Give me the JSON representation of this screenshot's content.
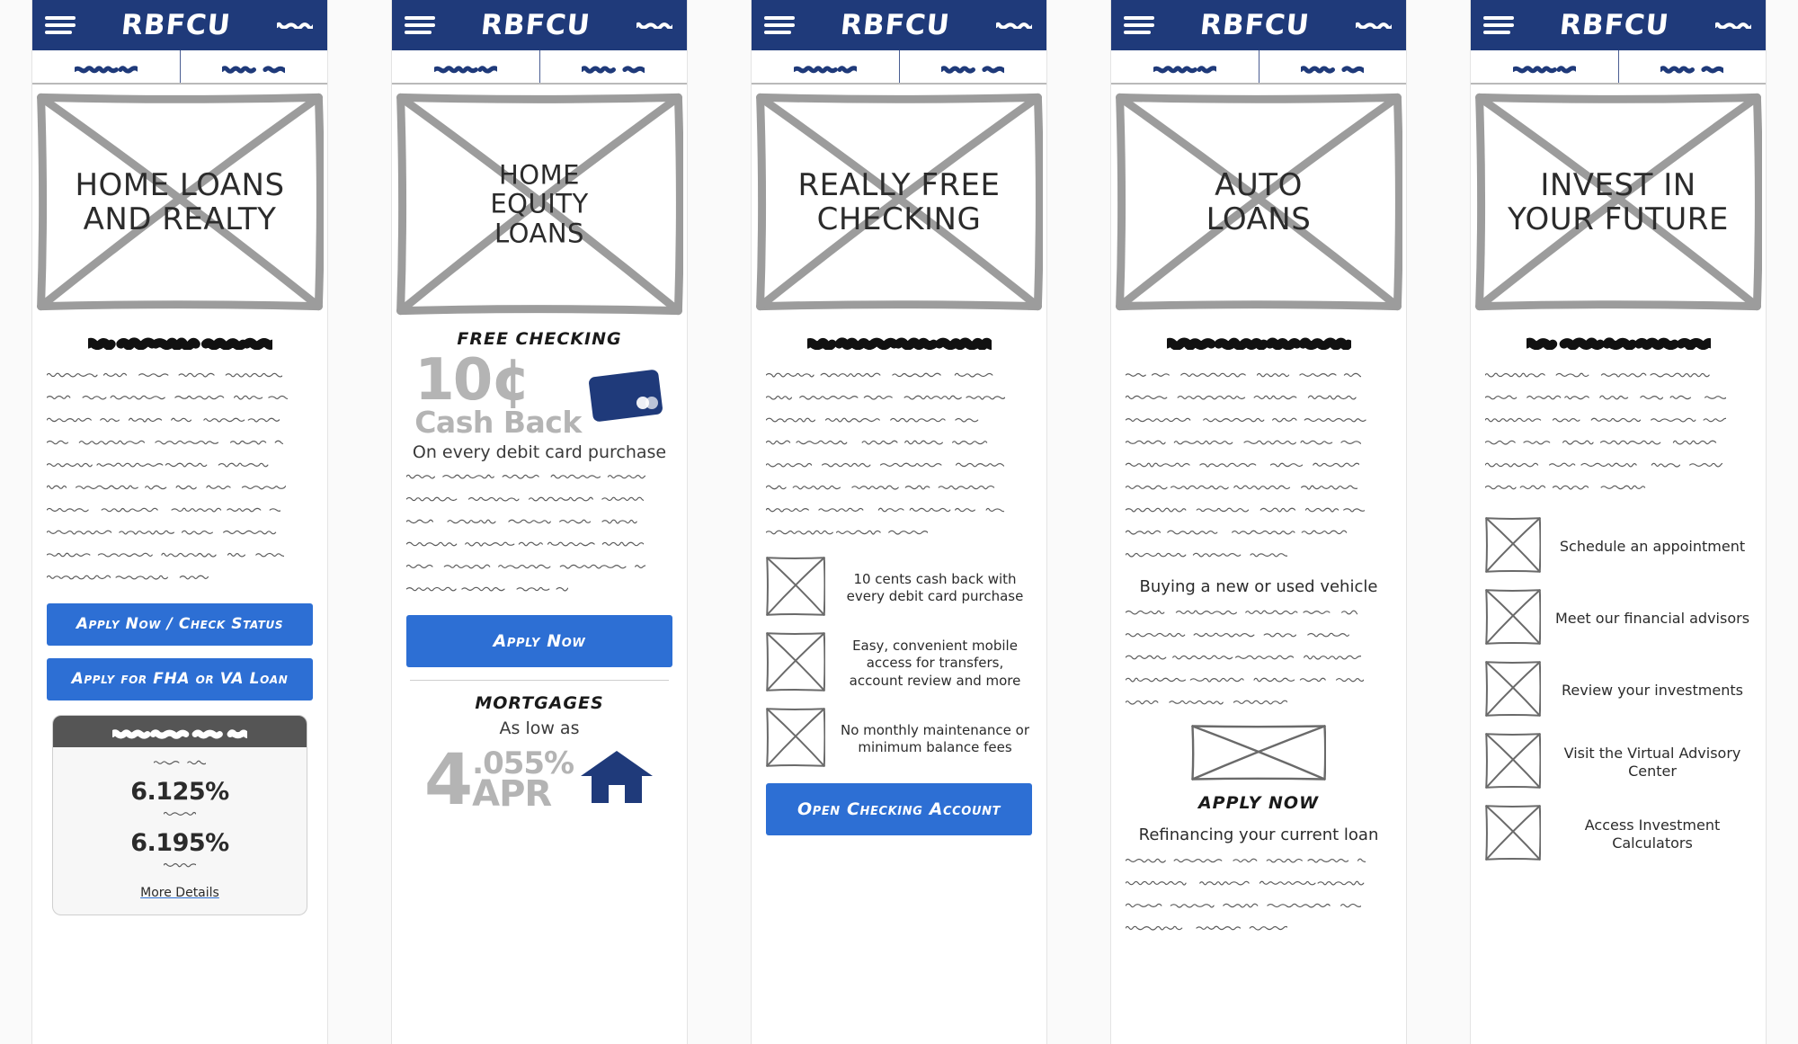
{
  "meta": {
    "brand": "RBFCU",
    "accent_blue": "#2d6fd4",
    "navy": "#1f3a7a",
    "wireframe_gray": "#9c9c9c",
    "panel_count": 5
  },
  "nav": {
    "menu_icon": "hamburger-icon",
    "brand": "RBFCU",
    "right_icon": "scribble-icon",
    "tabs": [
      "scribble-tab-1",
      "scribble-tab-2"
    ]
  },
  "panels": [
    {
      "id": "home-loans-and-realty",
      "hero_title": "HOME LOANS\nAND REALTY",
      "hero_lines": [
        "HOME LOANS",
        "AND REALTY"
      ],
      "heading_placeholder": "scribble-heading",
      "body_lines": 10,
      "buttons": [
        {
          "label": "Apply Now / Check Status",
          "name": "apply-now-check-status-button"
        },
        {
          "label": "Apply for FHA or VA Loan",
          "name": "apply-fha-va-loan-button"
        }
      ],
      "rate_card": {
        "header_placeholder": "scribble-card-header",
        "rates": [
          {
            "caption_placeholder": "scribble-caption",
            "value": "6.125%",
            "sub_placeholder": "scribble-sub"
          },
          {
            "caption_placeholder": "",
            "value": "6.195%",
            "sub_placeholder": "scribble-sub"
          }
        ],
        "more_details_label": "More Details"
      }
    },
    {
      "id": "home-equity-loans",
      "hero_lines": [
        "HOME",
        "EQUITY",
        "LOANS"
      ],
      "section_heading": "FREE CHECKING",
      "cashback": {
        "amount": "10¢",
        "label": "Cash Back",
        "icon": "debit-card-icon"
      },
      "cashback_caption": "On every debit card purchase",
      "body_lines": 6,
      "buttons": [
        {
          "label": "Apply Now",
          "name": "apply-now-button"
        }
      ],
      "mortgages": {
        "heading": "MORTGAGES",
        "subheading": "As low as",
        "rate_whole": "4",
        "rate_decimal": ".055%",
        "rate_word": "APR",
        "icon": "house-icon"
      }
    },
    {
      "id": "really-free-checking",
      "hero_lines": [
        "REALLY FREE",
        "CHECKING"
      ],
      "heading_placeholder": "scribble-heading",
      "body_lines": 8,
      "features": [
        "10 cents cash back with every debit card purchase",
        "Easy, convenient mobile access for transfers, account review and more",
        "No monthly maintenance or minimum balance fees"
      ],
      "buttons": [
        {
          "label": "Open Checking Account",
          "name": "open-checking-account-button"
        }
      ]
    },
    {
      "id": "auto-loans",
      "hero_lines": [
        "AUTO",
        "LOANS"
      ],
      "heading_placeholder": "scribble-heading",
      "body_lines": 9,
      "subheading_buying": "Buying a new or used vehicle",
      "body_lines_2": 5,
      "wide_box": "wireframe-image-placeholder",
      "apply_heading": "APPLY NOW",
      "subheading_refi": "Refinancing your current loan",
      "body_lines_3": 4
    },
    {
      "id": "invest-in-your-future",
      "hero_lines": [
        "INVEST IN",
        "YOUR FUTURE"
      ],
      "heading_placeholder": "scribble-heading",
      "body_lines": 6,
      "list": [
        "Schedule an appointment",
        "Meet our financial advisors",
        "Review your investments",
        "Visit the Virtual Advisory Center",
        "Access Investment Calculators"
      ]
    }
  ]
}
